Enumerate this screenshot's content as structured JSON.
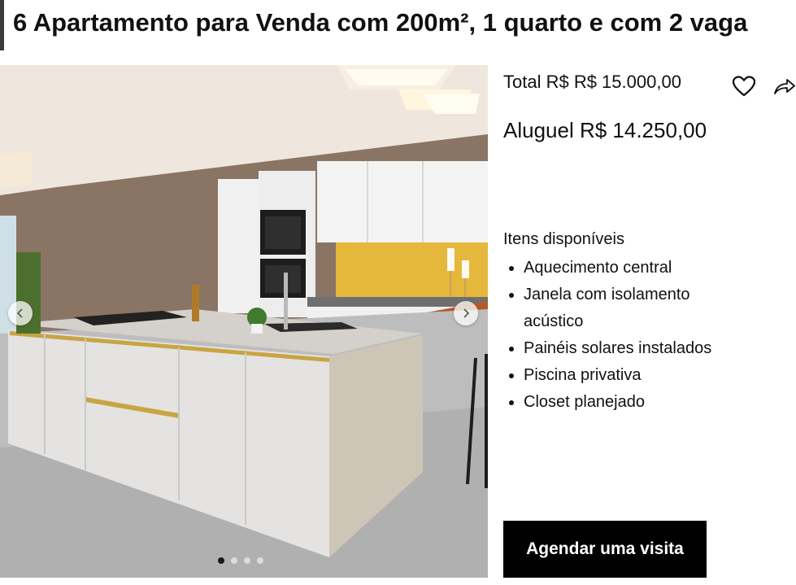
{
  "listing": {
    "title": "6 Apartamento para Venda com 200m², 1 quarto e com 2 vaga"
  },
  "gallery": {
    "image_alt": "kitchen-photo",
    "prev_icon": "chevron-left-icon",
    "next_icon": "chevron-right-icon",
    "slide_count": 4,
    "active_slide": 1
  },
  "pricing": {
    "total": "Total R$ R$ 15.000,00",
    "rent": "Aluguel R$ 14.250,00"
  },
  "actions": {
    "favorite_icon": "heart-icon",
    "share_icon": "share-icon"
  },
  "features": {
    "title": "Itens disponíveis",
    "items": [
      "Aquecimento central",
      "Janela com isolamento acústico",
      "Painéis solares instalados",
      "Piscina privativa",
      "Closet planejado"
    ]
  },
  "cta": {
    "label": "Agendar uma visita"
  },
  "colors": {
    "cta_background": "#000000",
    "cta_text": "#ffffff",
    "title_accent_bar": "#3a3a3a"
  }
}
